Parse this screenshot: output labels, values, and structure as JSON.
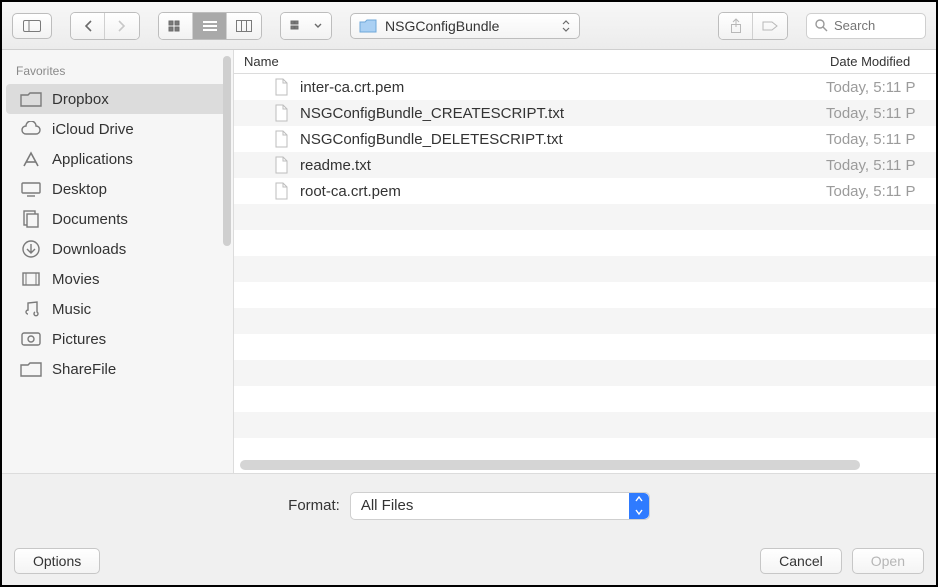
{
  "toolbar": {
    "current_folder": "NSGConfigBundle",
    "search_placeholder": "Search"
  },
  "sidebar": {
    "section_label": "Favorites",
    "items": [
      {
        "label": "Dropbox",
        "icon": "folder-icon",
        "selected": true
      },
      {
        "label": "iCloud Drive",
        "icon": "cloud-icon",
        "selected": false
      },
      {
        "label": "Applications",
        "icon": "app-icon",
        "selected": false
      },
      {
        "label": "Desktop",
        "icon": "desktop-icon",
        "selected": false
      },
      {
        "label": "Documents",
        "icon": "documents-icon",
        "selected": false
      },
      {
        "label": "Downloads",
        "icon": "downloads-icon",
        "selected": false
      },
      {
        "label": "Movies",
        "icon": "movies-icon",
        "selected": false
      },
      {
        "label": "Music",
        "icon": "music-icon",
        "selected": false
      },
      {
        "label": "Pictures",
        "icon": "pictures-icon",
        "selected": false
      },
      {
        "label": "ShareFile",
        "icon": "folder-icon",
        "selected": false
      }
    ]
  },
  "filelist": {
    "columns": {
      "name": "Name",
      "date": "Date Modified"
    },
    "rows": [
      {
        "name": "inter-ca.crt.pem",
        "modified": "Today, 5:11 P"
      },
      {
        "name": "NSGConfigBundle_CREATESCRIPT.txt",
        "modified": "Today, 5:11 P"
      },
      {
        "name": "NSGConfigBundle_DELETESCRIPT.txt",
        "modified": "Today, 5:11 P"
      },
      {
        "name": "readme.txt",
        "modified": "Today, 5:11 P"
      },
      {
        "name": "root-ca.crt.pem",
        "modified": "Today, 5:11 P"
      }
    ]
  },
  "format": {
    "label": "Format:",
    "selected": "All Files"
  },
  "buttons": {
    "options": "Options",
    "cancel": "Cancel",
    "open": "Open"
  }
}
